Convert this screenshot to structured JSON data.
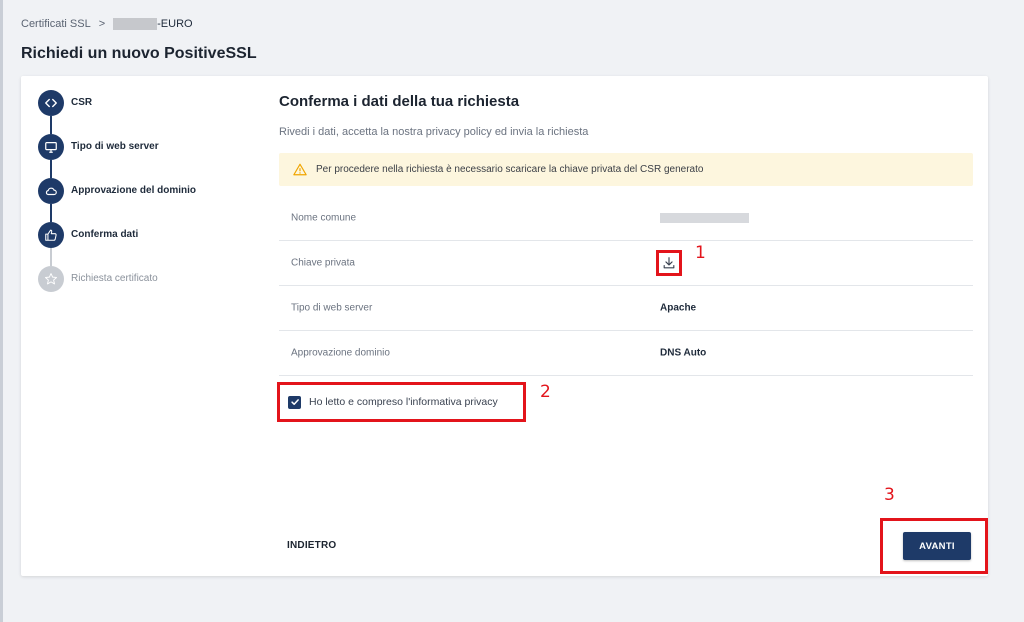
{
  "breadcrumb": {
    "item1": "Certificati SSL",
    "separator": ">",
    "item2_suffix": "-EURO"
  },
  "page_title": "Richiedi un nuovo PositiveSSL",
  "stepper": {
    "steps": [
      {
        "label": "CSR",
        "icon": "code-icon",
        "state": "done"
      },
      {
        "label": "Tipo di web server",
        "icon": "monitor-icon",
        "state": "done"
      },
      {
        "label": "Approvazione del dominio",
        "icon": "cloud-icon",
        "state": "done"
      },
      {
        "label": "Conferma dati",
        "icon": "thumbs-up-icon",
        "state": "active"
      },
      {
        "label": "Richiesta certificato",
        "icon": "star-icon",
        "state": "pending"
      }
    ]
  },
  "main": {
    "title": "Conferma i dati della tua richiesta",
    "subtitle": "Rivedi i dati, accetta la nostra privacy policy ed invia la richiesta",
    "alert": "Per procedere nella richiesta è necessario scaricare la chiave privata del CSR generato",
    "rows": [
      {
        "key": "Nome comune",
        "value": ""
      },
      {
        "key": "Chiave privata",
        "value": ""
      },
      {
        "key": "Tipo di web server",
        "value": "Apache"
      },
      {
        "key": "Approvazione dominio",
        "value": "DNS Auto"
      }
    ],
    "privacy_label": "Ho letto e compreso l'informativa privacy",
    "privacy_checked": true
  },
  "actions": {
    "back": "INDIETRO",
    "next": "AVANTI"
  },
  "markers": {
    "m1": "1",
    "m2": "2",
    "m3": "3"
  },
  "colors": {
    "primary": "#1e3a68",
    "highlight": "#e3141b",
    "alert_bg": "#fdf6de",
    "warning": "#f0a500"
  }
}
